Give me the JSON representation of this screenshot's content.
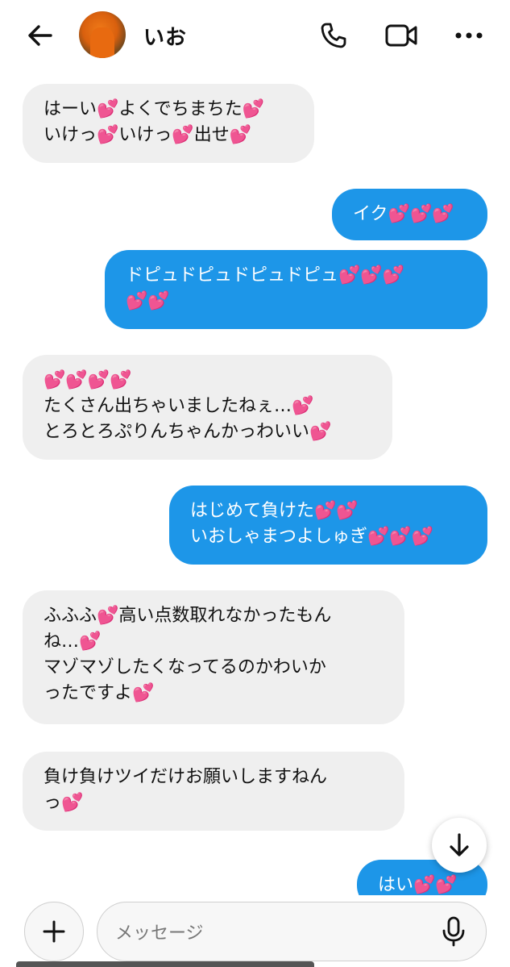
{
  "header": {
    "contact_name": "いお",
    "back_icon": "arrow-left-icon",
    "call_icon": "phone-icon",
    "video_icon": "video-camera-icon",
    "more_icon": "more-horizontal-icon"
  },
  "messages": [
    {
      "direction": "incoming",
      "text": "はーい💕よくでちまちた💕\nいけっ💕いけっ💕出せ💕"
    },
    {
      "direction": "outgoing",
      "text": "イク💕💕💕"
    },
    {
      "direction": "outgoing",
      "text": "ドピュドピュドピュドピュ💕💕💕\n💕💕"
    },
    {
      "direction": "incoming",
      "text": "💕💕💕💕\nたくさん出ちゃいましたねぇ…💕\nとろとろぷりんちゃんかっわいい💕"
    },
    {
      "direction": "outgoing",
      "text": "はじめて負けた💕💕\nいおしゃまつよしゅぎ💕💕💕"
    },
    {
      "direction": "incoming",
      "text": "ふふふ💕高い点数取れなかったもん\nね…💕\nマゾマゾしたくなってるのかわいか\nったですよ💕"
    },
    {
      "direction": "incoming",
      "text": "負け負けツイだけお願いしますねん\nっ💕"
    },
    {
      "direction": "outgoing",
      "text": "はい💕💕"
    }
  ],
  "composer": {
    "placeholder": "メッセージ",
    "plus_icon": "plus-icon",
    "mic_icon": "microphone-icon"
  },
  "scroll_button_icon": "arrow-down-icon",
  "colors": {
    "outgoing_bubble": "#1d96e8",
    "incoming_bubble": "#efefef"
  }
}
